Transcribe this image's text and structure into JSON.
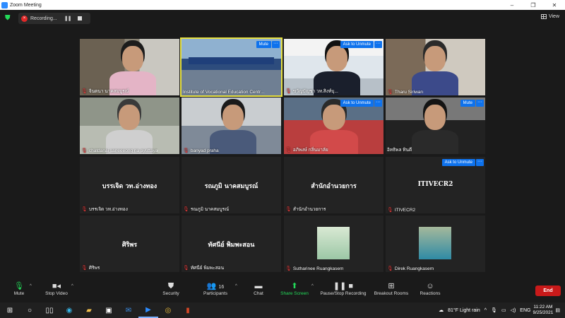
{
  "window": {
    "title": "Zoom Meeting"
  },
  "recording": {
    "label": "Recording..."
  },
  "view_label": "View",
  "tiles": [
    {
      "name": "จินตนา นาคสมบูรณ์",
      "muted": true
    },
    {
      "name": "Institute of Vocational Education Centr...",
      "muted": false,
      "button": "Mute"
    },
    {
      "name": "ขวัญบัญชา วท.สิงห์บุ...",
      "muted": true,
      "button": "Ask to Unmute"
    },
    {
      "name": "Tharu Siriwan",
      "muted": true
    },
    {
      "name": "chatdanai saneeeong na ayuttaya",
      "muted": true
    },
    {
      "name": "banyad praha",
      "muted": true
    },
    {
      "name": "อภิพงษ์ กลิ่นมาลัย",
      "muted": true,
      "button": "Ask to Unmute"
    },
    {
      "name": "อิทธิพล ทินดี",
      "muted": false,
      "button": "Mute"
    },
    {
      "name": "บรรเจิด วท.อ่างทอง",
      "center": "บรรเจิด วท.อ่างทอง",
      "muted": true
    },
    {
      "name": "รณภูมิ นาคสมบูรณ์",
      "center": "รณภูมิ นาคสมบูรณ์",
      "muted": true
    },
    {
      "name": "สำนักอำนวยการ",
      "center": "สำนักอำนวยการ",
      "muted": true
    },
    {
      "name": "ITIVECR2",
      "center": "ITIVECR2",
      "muted": true,
      "button": "Ask to Unmute"
    },
    {
      "name": "ศิริพร",
      "center": "ศิริพร",
      "muted": true
    },
    {
      "name": "ทัศนีย์ พิมพะสอน",
      "center": "ทัศนีย์ พิมพะสอน",
      "muted": true
    },
    {
      "name": "Sutharinee Ruangkasem",
      "muted": true
    },
    {
      "name": "Direk Ruangkasem",
      "muted": true
    }
  ],
  "toolbar": {
    "mute": "Mute",
    "stop_video": "Stop Video",
    "security": "Security",
    "participants": "Participants",
    "participants_count": "16",
    "chat": "Chat",
    "share_screen": "Share Screen",
    "pause_stop_recording": "Pause/Stop Recording",
    "breakout_rooms": "Breakout Rooms",
    "reactions": "Reactions",
    "end": "End"
  },
  "taskbar": {
    "weather": "81°F  Light rain",
    "language": "ENG",
    "time": "11:22 AM",
    "date": "9/25/2021"
  },
  "colors": {
    "accent": "#0e72ed",
    "end": "#c91a1a",
    "muted": "#e23b3b",
    "active_speaker": "#e7e040"
  }
}
